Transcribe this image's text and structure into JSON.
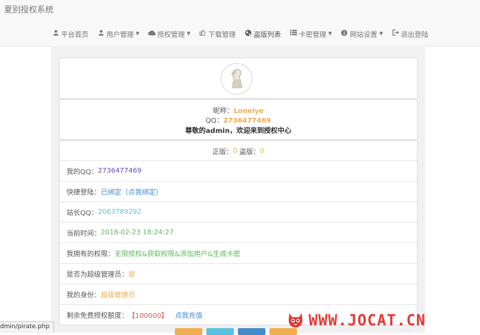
{
  "brand": "夏别授权系统",
  "nav": [
    {
      "icon": "user-icon",
      "label": "平台首页",
      "dropdown": false
    },
    {
      "icon": "user-icon",
      "label": "用户管理",
      "dropdown": true
    },
    {
      "icon": "cloud-icon",
      "label": "授权管理",
      "dropdown": true
    },
    {
      "icon": "thumbs-up-icon",
      "label": "下载管理",
      "dropdown": false
    },
    {
      "icon": "globe-icon",
      "label": "盗版列表",
      "dropdown": false
    },
    {
      "icon": "list-icon",
      "label": "卡密管理",
      "dropdown": true
    },
    {
      "icon": "info-icon",
      "label": "网站设置",
      "dropdown": true
    },
    {
      "icon": "logout-icon",
      "label": "退出登陆",
      "dropdown": false
    }
  ],
  "profile": {
    "nickname_label": "昵称：",
    "nickname": "Lonelye",
    "qq_label": "QQ：",
    "qq": "2736477469",
    "welcome": "尊敬的admin，欢迎来到授权中心"
  },
  "counts": {
    "genuine_label": "正版：",
    "genuine": "0",
    "pirate_label": "盗版：",
    "pirate": "0"
  },
  "rows": [
    {
      "label": "我的QQ：",
      "value": "2736477469",
      "tone": "purple"
    },
    {
      "label": "快捷登陆：",
      "value": "已绑定",
      "extra": "（点我绑定）",
      "tone": "blue"
    },
    {
      "label": "站长QQ：",
      "value": "2063789292",
      "tone": "cyan"
    },
    {
      "label": "当前时间：",
      "value": "2018-02-23 18:24:27",
      "tone": "green"
    },
    {
      "label": "我拥有的权限：",
      "value": "无限授权&获取权限&添加用户&生成卡密",
      "tone": "green"
    },
    {
      "label": "是否为超级管理员：",
      "value": "是",
      "tone": "orange"
    },
    {
      "label": "我的身份：",
      "value": "超级管理员",
      "tone": "orange"
    },
    {
      "label": "剩余免费授权额度：",
      "value": "【100000】",
      "extra": "点我充值",
      "tone": "red"
    }
  ],
  "status_url": "dmin/pirate.php",
  "watermark": "WWW.JOCAT.CN",
  "colors": {
    "accent_orange": "#f0ad4e",
    "accent_blue": "#428bca",
    "accent_green": "#5cb85c",
    "accent_red": "#d9534f",
    "watermark_red": "#e53935"
  }
}
